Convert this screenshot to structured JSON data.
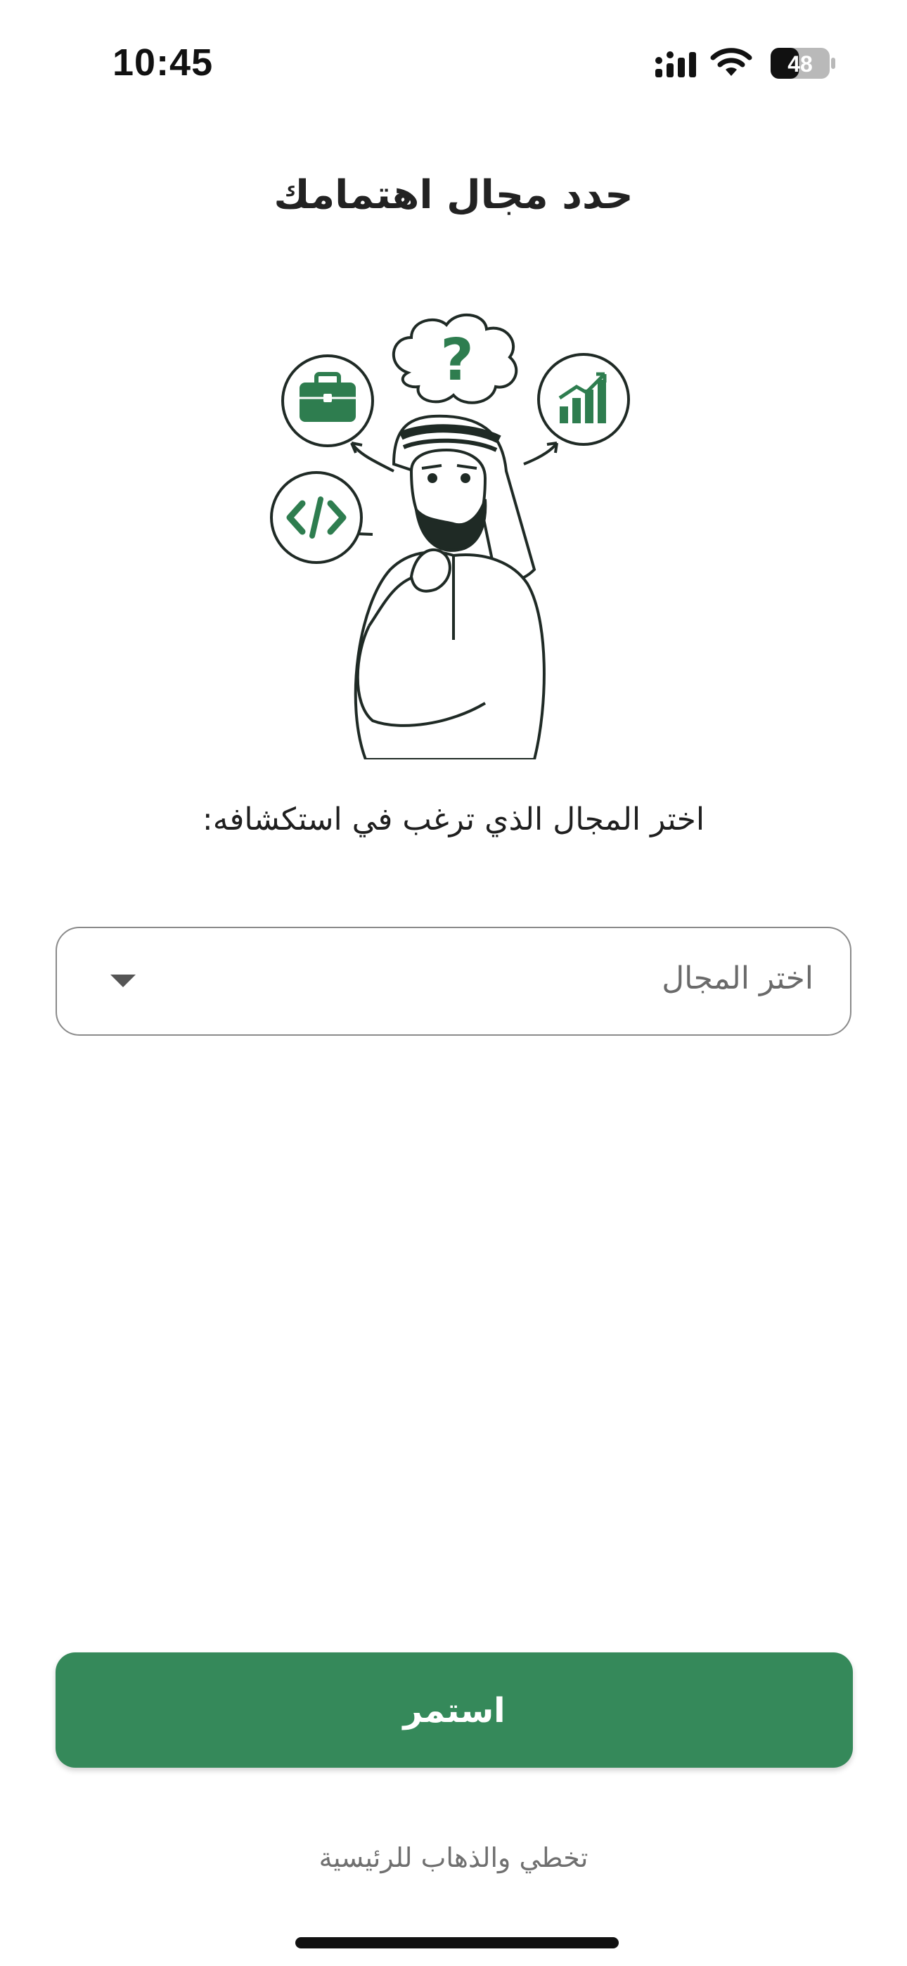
{
  "status_bar": {
    "time": "10:45",
    "battery_level": "48",
    "battery_percent": 48,
    "icons": [
      "cellular-signal-icon",
      "wifi-icon",
      "battery-icon"
    ]
  },
  "screen": {
    "title": "حدد مجال اهتمامك",
    "illustration": {
      "thought_symbol": "?",
      "icons": [
        "briefcase-icon",
        "code-icon",
        "bar-chart-icon",
        "question-cloud-icon"
      ]
    },
    "prompt": "اختر المجال الذي ترغب في استكشافه:",
    "field_select": {
      "placeholder": "اختر المجال",
      "value": ""
    },
    "continue_label": "استمر",
    "skip_label": "تخطي والذهاب للرئيسية"
  },
  "colors": {
    "accent": "#35895a",
    "illustration_green": "#2e7d4f",
    "text_primary": "#1f1f1f",
    "text_muted": "#707070",
    "border": "#8a8a8a"
  }
}
